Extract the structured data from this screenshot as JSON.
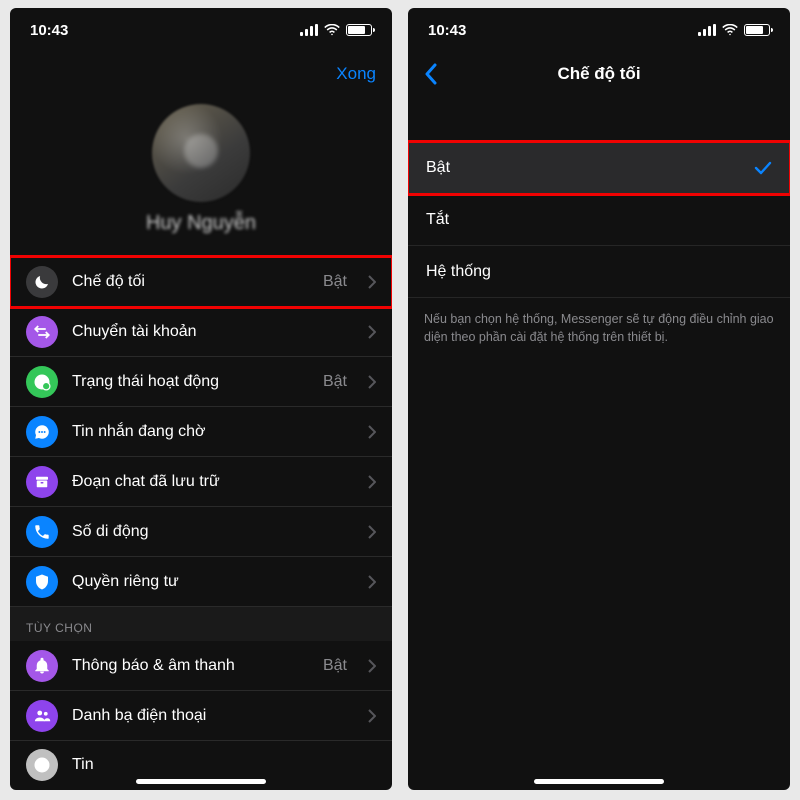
{
  "status": {
    "time": "10:43"
  },
  "left": {
    "done": "Xong",
    "profile": {
      "name": "Huy Nguyễn"
    },
    "rows": {
      "dark": {
        "label": "Chế độ tối",
        "value": "Bật"
      },
      "switch": {
        "label": "Chuyển tài khoản"
      },
      "status": {
        "label": "Trạng thái hoạt động",
        "value": "Bật"
      },
      "wait": {
        "label": "Tin nhắn đang chờ"
      },
      "archive": {
        "label": "Đoạn chat đã lưu trữ"
      },
      "phone": {
        "label": "Số di động"
      },
      "privacy": {
        "label": "Quyền riêng tư"
      }
    },
    "section": "TÙY CHỌN",
    "rows2": {
      "bell": {
        "label": "Thông báo & âm thanh",
        "value": "Bật"
      },
      "contacts": {
        "label": "Danh bạ điện thoại"
      },
      "tin": {
        "label": "Tin"
      }
    }
  },
  "right": {
    "title": "Chế độ tối",
    "options": {
      "on": "Bật",
      "off": "Tắt",
      "sys": "Hệ thống"
    },
    "footnote": "Nếu bạn chọn hệ thống, Messenger sẽ tự động điều chỉnh giao diện theo phần cài đặt hệ thống trên thiết bị."
  }
}
